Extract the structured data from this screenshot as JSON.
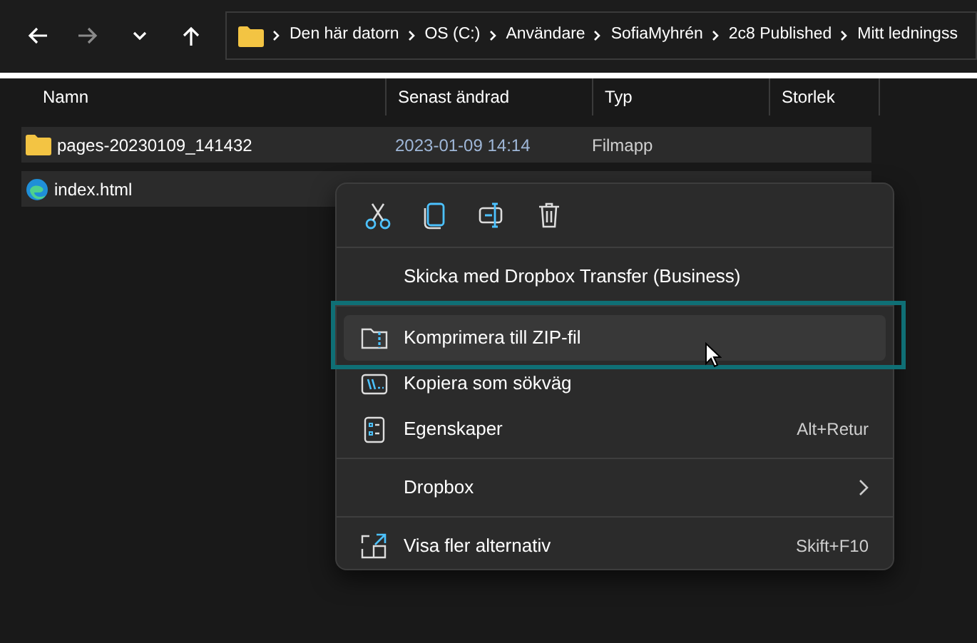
{
  "nav_buttons": [
    {
      "kind": "back",
      "disabled": false
    },
    {
      "kind": "forward",
      "disabled": true
    },
    {
      "kind": "recent",
      "disabled": false
    },
    {
      "kind": "up",
      "disabled": false
    }
  ],
  "breadcrumb": [
    "Den här datorn",
    "OS (C:)",
    "Användare",
    "SofiaMyhrén",
    "2c8 Published",
    "Mitt ledningss"
  ],
  "columns": [
    "Namn",
    "Senast ändrad",
    "Typ",
    "Storlek"
  ],
  "rows": [
    {
      "kind": "folder",
      "name": "pages-20230109_141432",
      "modified": "2023-01-09 14:14",
      "type": "Filmapp",
      "selected": true
    },
    {
      "kind": "edge",
      "name": "index.html",
      "selected": true
    }
  ],
  "context_menu": {
    "toolbar": [
      {
        "kind": "cut"
      },
      {
        "kind": "copy"
      },
      {
        "kind": "rename"
      },
      {
        "kind": "delete"
      }
    ],
    "items": [
      {
        "kind": "plain",
        "label": "Skicka med Dropbox Transfer (Business)",
        "hovered": false
      },
      {
        "kind": "zip",
        "label": "Komprimera till ZIP-fil",
        "hovered": true,
        "annotated": true
      },
      {
        "kind": "path",
        "label": "Kopiera som sökväg",
        "hovered": false
      },
      {
        "kind": "props",
        "label": "Egenskaper",
        "shortcut": "Alt+Retur",
        "hovered": false
      },
      {
        "kind": "plain",
        "label": "Dropbox",
        "submenu": true,
        "hovered": false
      },
      {
        "kind": "more",
        "label": "Visa fler alternativ",
        "shortcut": "Skift+F10",
        "hovered": false
      }
    ]
  }
}
